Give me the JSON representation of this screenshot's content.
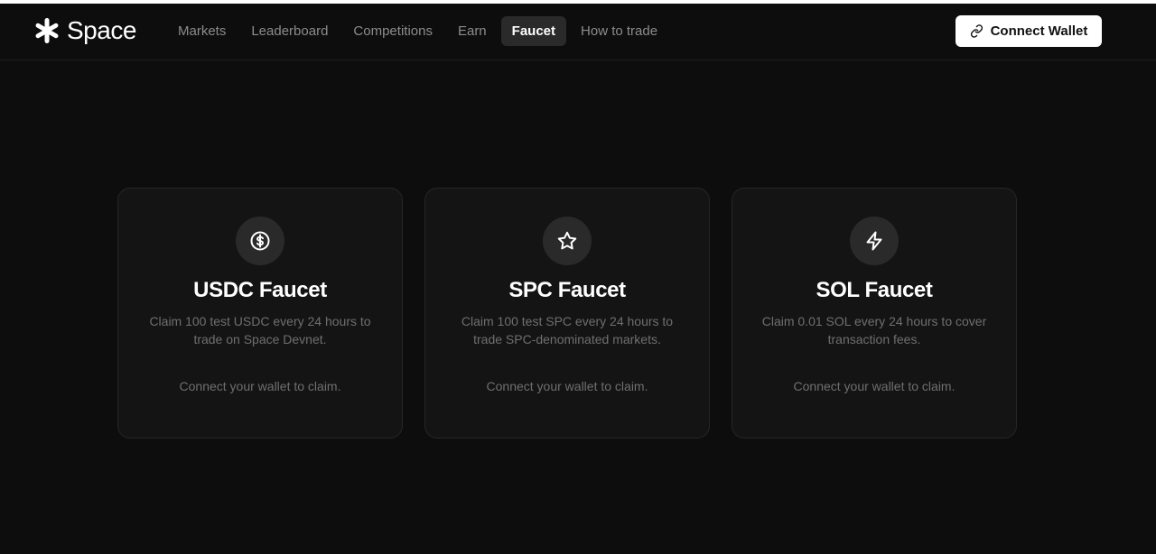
{
  "brand": {
    "name": "Space"
  },
  "nav": {
    "items": [
      {
        "label": "Markets",
        "active": false
      },
      {
        "label": "Leaderboard",
        "active": false
      },
      {
        "label": "Competitions",
        "active": false
      },
      {
        "label": "Earn",
        "active": false
      },
      {
        "label": "Faucet",
        "active": true
      },
      {
        "label": "How to trade",
        "active": false
      }
    ]
  },
  "header": {
    "connect_label": "Connect Wallet"
  },
  "faucets": [
    {
      "icon": "dollar-circle-icon",
      "title": "USDC Faucet",
      "description": "Claim 100 test USDC every 24 hours to trade on Space Devnet.",
      "status": "Connect your wallet to claim."
    },
    {
      "icon": "star-icon",
      "title": "SPC Faucet",
      "description": "Claim 100 test SPC every 24 hours to trade SPC-denominated markets.",
      "status": "Connect your wallet to claim."
    },
    {
      "icon": "lightning-icon",
      "title": "SOL Faucet",
      "description": "Claim 0.01 SOL every 24 hours to cover transaction fees.",
      "status": "Connect your wallet to claim."
    }
  ],
  "colors": {
    "background": "#0d0d0d",
    "card": "#141414",
    "card_border": "#262626",
    "muted_text": "#6f6f6f",
    "nav_text": "#8c8c8c",
    "active_tab": "#2a2a2a",
    "button": "#ffffff"
  }
}
